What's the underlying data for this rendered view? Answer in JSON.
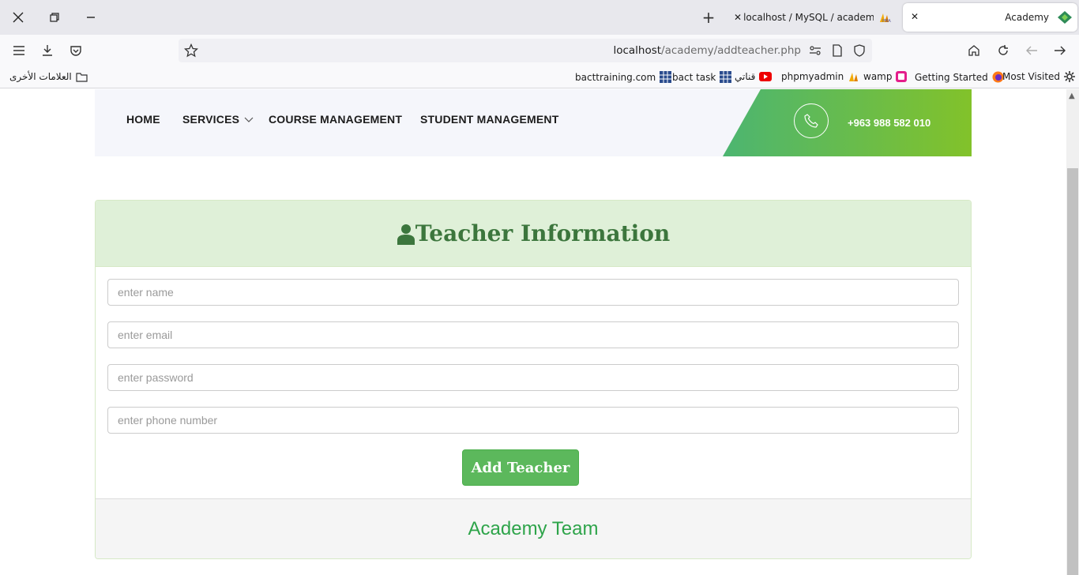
{
  "browser": {
    "tabs": [
      {
        "title": "Academy",
        "active": true
      },
      {
        "title": "localhost / MySQL / academy /",
        "active": false
      }
    ],
    "url_host": "localhost",
    "url_path": "/academy/addteacher.php",
    "bookmarks_left": "العلامات الأخرى",
    "bookmarks": [
      {
        "label": "Most Visited",
        "icon": "gear-icon"
      },
      {
        "label": "Getting Started",
        "icon": "firefox-icon"
      },
      {
        "label": "wamp",
        "icon": "wamp-icon"
      },
      {
        "label": "phpmyadmin",
        "icon": "pma-icon"
      },
      {
        "label": "قناتي",
        "icon": "youtube-icon"
      },
      {
        "label": "bact task",
        "icon": "grid-icon"
      },
      {
        "label": "bacttraining.com",
        "icon": "grid-icon"
      }
    ]
  },
  "site_nav": {
    "items": [
      "HOME",
      "SERVICES",
      "COURSE MANAGEMENT",
      "STUDENT MANAGEMENT"
    ],
    "phone": "+963 988 582 010"
  },
  "form": {
    "title": "Teacher Information",
    "name_placeholder": "enter name",
    "email_placeholder": "enter email",
    "password_placeholder": "enter password",
    "phone_placeholder": "enter phone number",
    "submit_label": "Add Teacher",
    "footer": "Academy Team"
  },
  "colors": {
    "heading_bg": "#dff0d8",
    "heading_text": "#3c763d",
    "button": "#5cb85c",
    "footer_text": "#2ea44a",
    "phone_gradient_start": "#4cb571",
    "phone_gradient_end": "#82c22a"
  }
}
